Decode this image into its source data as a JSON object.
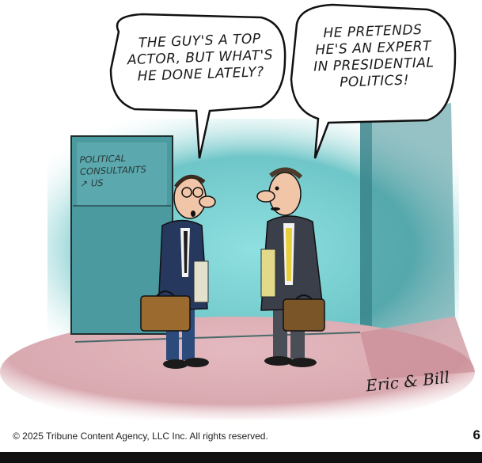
{
  "cartoon": {
    "left_bubble": "THE GUY'S A TOP\nACTOR, BUT WHAT'S\nHE DONE LATELY?",
    "right_bubble": "HE PRETENDS\nHE'S AN EXPERT\nIN PRESIDENTIAL\nPOLITICS!",
    "door_sign": "POLITICAL\nCONSULTANTS\n↗ US",
    "signature": "Eric & Bill"
  },
  "footer": {
    "copyright": "© 2025 Tribune Content Agency, LLC Inc. All rights reserved.",
    "page_number": "6"
  },
  "colors": {
    "wall_teal": "#6fc6c8",
    "floor_pink": "#d9a9b0",
    "suit_navy": "#26385e",
    "suit_charcoal": "#3b3f4a",
    "briefcase_brown": "#9a6a2e",
    "tie_yellow": "#e9cf3a"
  }
}
